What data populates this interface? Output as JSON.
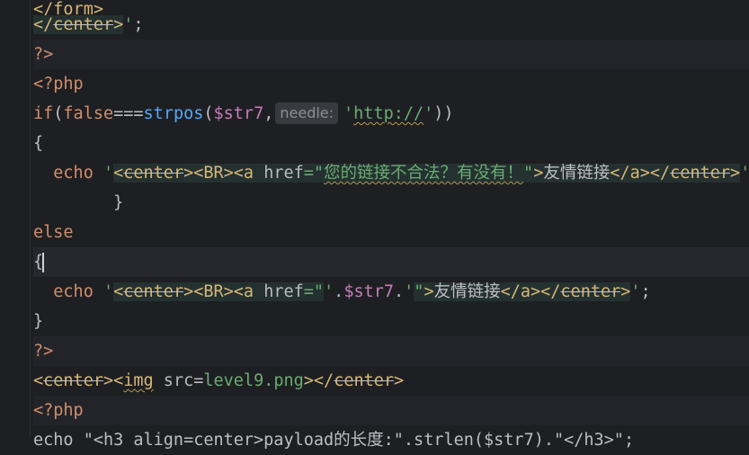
{
  "editor": {
    "lines": [
      {
        "segments": [
          {
            "t": "</form>",
            "c": "tag"
          }
        ]
      },
      {
        "segments": [
          {
            "t": "</",
            "c": "tag hl"
          },
          {
            "t": "center",
            "c": "tag hl strike"
          },
          {
            "t": ">",
            "c": "tag hl"
          },
          {
            "t": "'",
            "c": "str"
          },
          {
            "t": ";",
            "c": "plain"
          }
        ]
      },
      {
        "segments": [
          {
            "t": "?>",
            "c": "kw"
          }
        ]
      },
      {
        "segments": [
          {
            "t": "<?php",
            "c": "kw"
          }
        ]
      },
      {
        "segments": [
          {
            "t": "if",
            "c": "kw"
          },
          {
            "t": "(",
            "c": "plain"
          },
          {
            "t": "false",
            "c": "kw"
          },
          {
            "t": "===",
            "c": "op"
          },
          {
            "t": "strpos",
            "c": "fn"
          },
          {
            "t": "(",
            "c": "plain"
          },
          {
            "t": "$str7",
            "c": "var"
          },
          {
            "t": ",",
            "c": "plain"
          },
          {
            "t": "needle:",
            "c": "hint"
          },
          {
            "t": "'",
            "c": "str"
          },
          {
            "t": "http://",
            "c": "str warn"
          },
          {
            "t": "'",
            "c": "str"
          },
          {
            "t": "))",
            "c": "plain"
          }
        ]
      },
      {
        "segments": [
          {
            "t": "{",
            "c": "plain"
          }
        ]
      },
      {
        "segments": [
          {
            "t": "  echo ",
            "c": "kw"
          },
          {
            "t": "'",
            "c": "str"
          },
          {
            "t": "<",
            "c": "tag hl"
          },
          {
            "t": "center",
            "c": "tag hl strike"
          },
          {
            "t": "><BR><a ",
            "c": "tag hl"
          },
          {
            "t": "href",
            "c": "attr hl"
          },
          {
            "t": "=\"",
            "c": "str hl"
          },
          {
            "t": "您的链接不合法？有没有！",
            "c": "str hl warn cn"
          },
          {
            "t": "\"",
            "c": "str hl"
          },
          {
            "t": ">",
            "c": "tag hl"
          },
          {
            "t": "友情链接",
            "c": "plain hl cn"
          },
          {
            "t": "</a></",
            "c": "tag hl"
          },
          {
            "t": "center",
            "c": "tag hl strike"
          },
          {
            "t": ">",
            "c": "tag hl"
          },
          {
            "t": "'",
            "c": "str"
          },
          {
            "t": ";",
            "c": "plain"
          }
        ]
      },
      {
        "segments": [
          {
            "t": "        }",
            "c": "plain"
          }
        ]
      },
      {
        "segments": [
          {
            "t": "else",
            "c": "kw"
          }
        ]
      },
      {
        "segments": [
          {
            "t": "{",
            "c": "plain"
          },
          {
            "t": "",
            "c": "caret"
          }
        ]
      },
      {
        "segments": [
          {
            "t": "  echo ",
            "c": "kw"
          },
          {
            "t": "'",
            "c": "str"
          },
          {
            "t": "<",
            "c": "tag hl"
          },
          {
            "t": "center",
            "c": "tag hl strike"
          },
          {
            "t": "><BR><a ",
            "c": "tag hl"
          },
          {
            "t": "href",
            "c": "attr hl"
          },
          {
            "t": "=\"",
            "c": "str hl"
          },
          {
            "t": "'",
            "c": "str"
          },
          {
            "t": ".",
            "c": "plain"
          },
          {
            "t": "$str7",
            "c": "var"
          },
          {
            "t": ".",
            "c": "plain"
          },
          {
            "t": "'",
            "c": "str"
          },
          {
            "t": "\"",
            "c": "str hl"
          },
          {
            "t": ">",
            "c": "tag hl"
          },
          {
            "t": "友情链接",
            "c": "plain hl cn"
          },
          {
            "t": "</a></",
            "c": "tag hl"
          },
          {
            "t": "center",
            "c": "tag hl strike"
          },
          {
            "t": ">",
            "c": "tag hl"
          },
          {
            "t": "'",
            "c": "str"
          },
          {
            "t": ";",
            "c": "plain"
          }
        ]
      },
      {
        "segments": [
          {
            "t": "}",
            "c": "plain"
          }
        ]
      },
      {
        "segments": [
          {
            "t": "?>",
            "c": "kw"
          }
        ]
      },
      {
        "segments": [
          {
            "t": "<",
            "c": "tag"
          },
          {
            "t": "center",
            "c": "tag strike"
          },
          {
            "t": "><",
            "c": "tag"
          },
          {
            "t": "img",
            "c": "tag warn"
          },
          {
            "t": " src",
            "c": "attr"
          },
          {
            "t": "=",
            "c": "plain"
          },
          {
            "t": "level9.png",
            "c": "str"
          },
          {
            "t": "></",
            "c": "tag"
          },
          {
            "t": "center",
            "c": "tag strike"
          },
          {
            "t": ">",
            "c": "tag"
          }
        ]
      },
      {
        "segments": [
          {
            "t": "<?php",
            "c": "kw"
          }
        ]
      },
      {
        "segments": [
          {
            "t": "echo \"<h3 align=center>payload的长度:\".strlen($str7).\"</h3>\";",
            "c": "plain"
          }
        ]
      }
    ]
  }
}
